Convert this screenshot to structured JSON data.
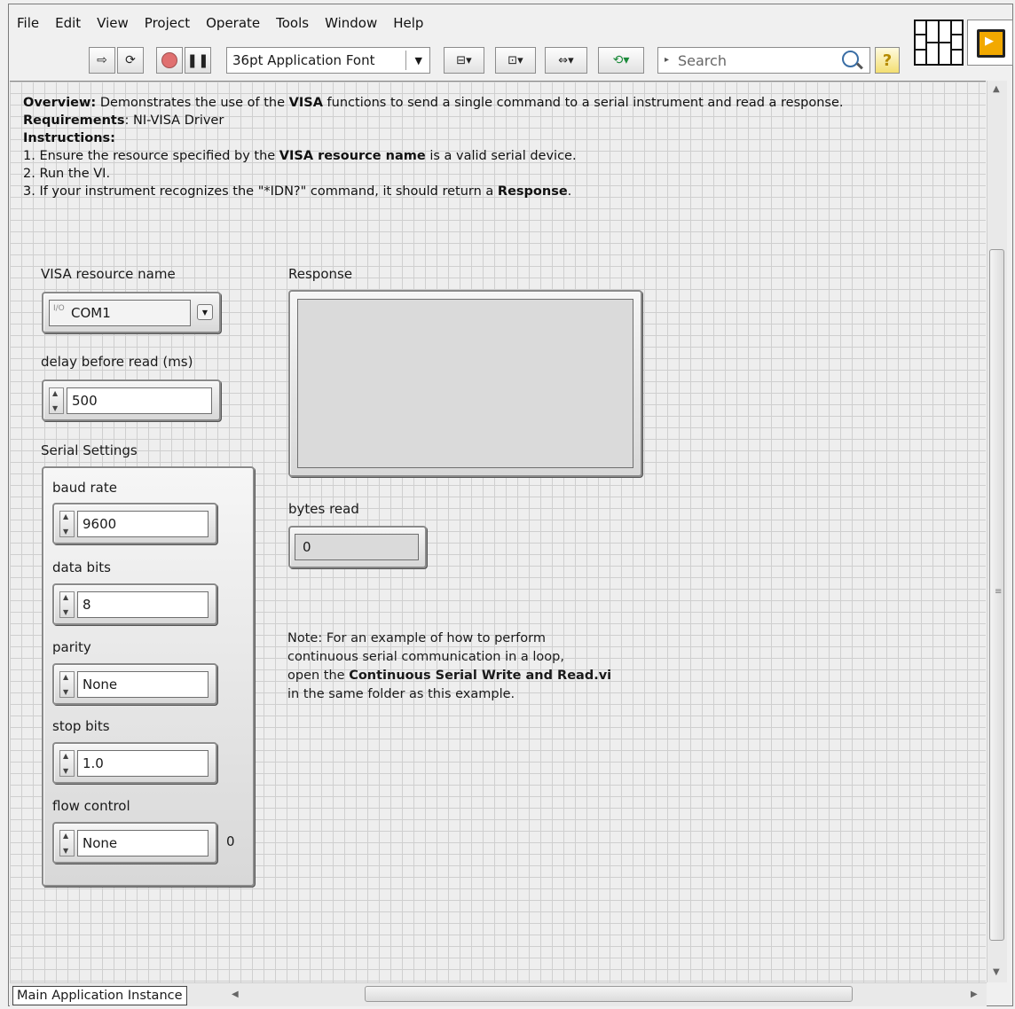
{
  "menu": [
    "File",
    "Edit",
    "View",
    "Project",
    "Operate",
    "Tools",
    "Window",
    "Help"
  ],
  "toolbar": {
    "font_label": "36pt Application Font",
    "search_placeholder": "Search",
    "help_glyph": "?"
  },
  "description": {
    "overview_label": "Overview:",
    "overview_text_1": " Demonstrates the use of the ",
    "overview_bold": "VISA",
    "overview_text_2": " functions to send a single command to a serial instrument and read a response.",
    "requirements_label": "Requirements",
    "requirements_text": ": NI-VISA Driver",
    "instructions_label": "Instructions:",
    "step1_a": "1. Ensure the resource specified by the ",
    "step1_bold": "VISA resource name",
    "step1_b": " is a valid serial device.",
    "step2": "2. Run the VI.",
    "step3_a": "3. If your instrument recognizes the \"*IDN?\" command, it should return a ",
    "step3_bold": "Response",
    "step3_b": "."
  },
  "controls": {
    "visa_label": "VISA resource name",
    "visa_value": "COM1",
    "visa_io_glyph": "I/O",
    "delay_label": "delay before read (ms)",
    "delay_value": "500",
    "serial_label": "Serial Settings",
    "baud_label": "baud rate",
    "baud_value": "9600",
    "databits_label": "data bits",
    "databits_value": "8",
    "parity_label": "parity",
    "parity_value": "None",
    "stopbits_label": "stop bits",
    "stopbits_value": "1.0",
    "flow_label": "flow control",
    "flow_value": "None",
    "flow_index": "0"
  },
  "indicators": {
    "response_label": "Response",
    "response_value": "",
    "bytes_label": "bytes read",
    "bytes_value": "0"
  },
  "note": {
    "text_1": "Note: For an example of how to perform",
    "text_2": "continuous serial communication in a loop,",
    "text_3a": "open the ",
    "text_3_bold": "Continuous Serial Write and Read.vi",
    "text_4": "in the same folder as this example."
  },
  "statusbar": {
    "instance": "Main Application Instance"
  }
}
